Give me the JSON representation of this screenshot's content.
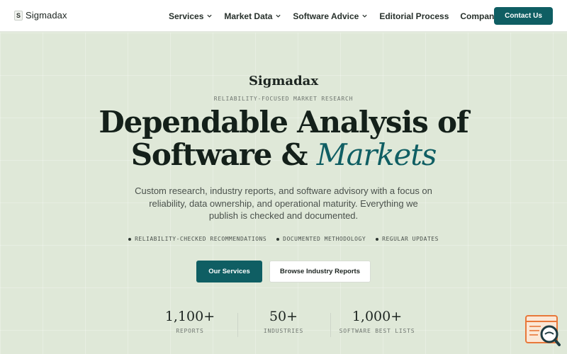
{
  "header": {
    "logo_mark": "S",
    "logo_text": "Sigmadax",
    "nav": [
      {
        "label": "Services"
      },
      {
        "label": "Market Data"
      },
      {
        "label": "Software Advice"
      },
      {
        "label": "Editorial Process"
      },
      {
        "label": "Company"
      }
    ],
    "contact_label": "Contact Us"
  },
  "hero": {
    "brand": "Sigmadax",
    "eyebrow": "RELIABILITY-FOCUSED MARKET RESEARCH",
    "headline_line1": "Dependable Analysis of",
    "headline_line2_plain": "Software &",
    "headline_line2_accent": "Markets",
    "subtext": "Custom research, industry reports, and software advisory with a focus on reliability, data ownership, and operational maturity. Everything we publish is checked and documented.",
    "features": [
      "RELIABILITY-CHECKED RECOMMENDATIONS",
      "DOCUMENTED METHODOLOGY",
      "REGULAR UPDATES"
    ],
    "primary_cta": "Our Services",
    "secondary_cta": "Browse Industry Reports"
  },
  "stats": [
    {
      "value": "1,100+",
      "label": "REPORTS"
    },
    {
      "value": "50+",
      "label": "INDUSTRIES"
    },
    {
      "value": "1,000+",
      "label": "SOFTWARE BEST LISTS"
    }
  ],
  "colors": {
    "accent": "#0f5e63",
    "background": "#dfe8d8",
    "widget": "#e8783a"
  },
  "icons": {
    "chat_widget": "search-document-icon",
    "nav_dropdown": "chevron-down-icon"
  }
}
